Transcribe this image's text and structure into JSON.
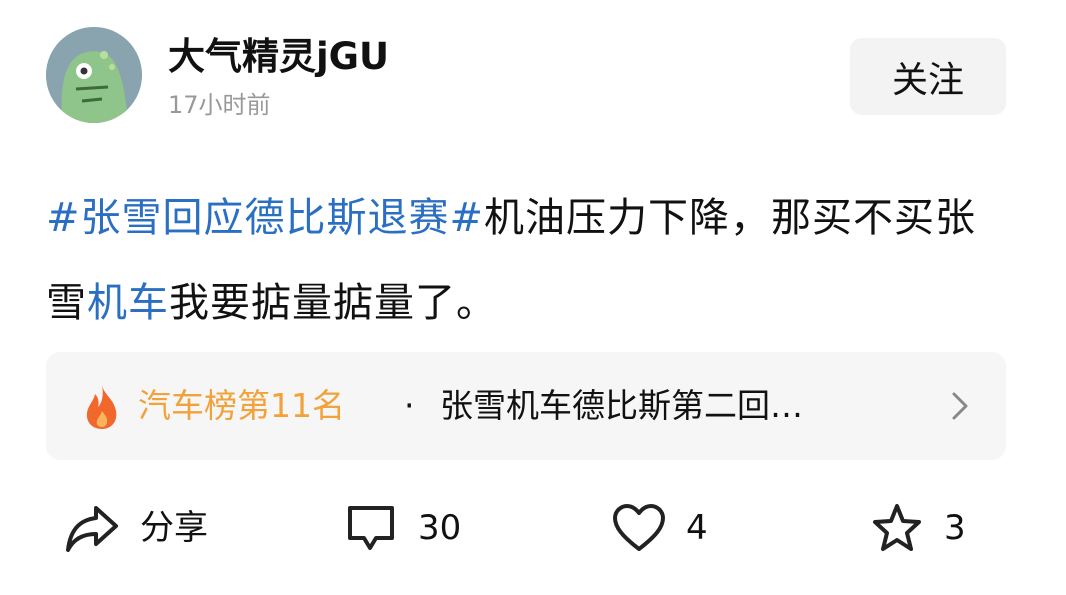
{
  "post": {
    "author": {
      "name": "大气精灵jGU",
      "avatar": "dinosaur-avatar"
    },
    "timestamp": "17小时前",
    "follow_label": "关注",
    "content": {
      "hashtag": "#张雪回应德比斯退赛#",
      "text_1": "机油压力下降，那买不买张雪",
      "keyword_link": "机车",
      "text_2": "我要掂量掂量了。"
    },
    "hot_card": {
      "icon": "flame-icon",
      "rank": "汽车榜第11名",
      "separator": "·",
      "title": "张雪机车德比斯第二回…"
    },
    "actions": {
      "share": {
        "icon": "share-icon",
        "label": "分享"
      },
      "comment": {
        "icon": "comment-icon",
        "count": "30"
      },
      "like": {
        "icon": "heart-icon",
        "count": "4"
      },
      "favorite": {
        "icon": "star-icon",
        "count": "3"
      }
    }
  },
  "colors": {
    "link": "#2b6fc2",
    "rank": "#f2a23b",
    "flame": "#f2682c"
  }
}
